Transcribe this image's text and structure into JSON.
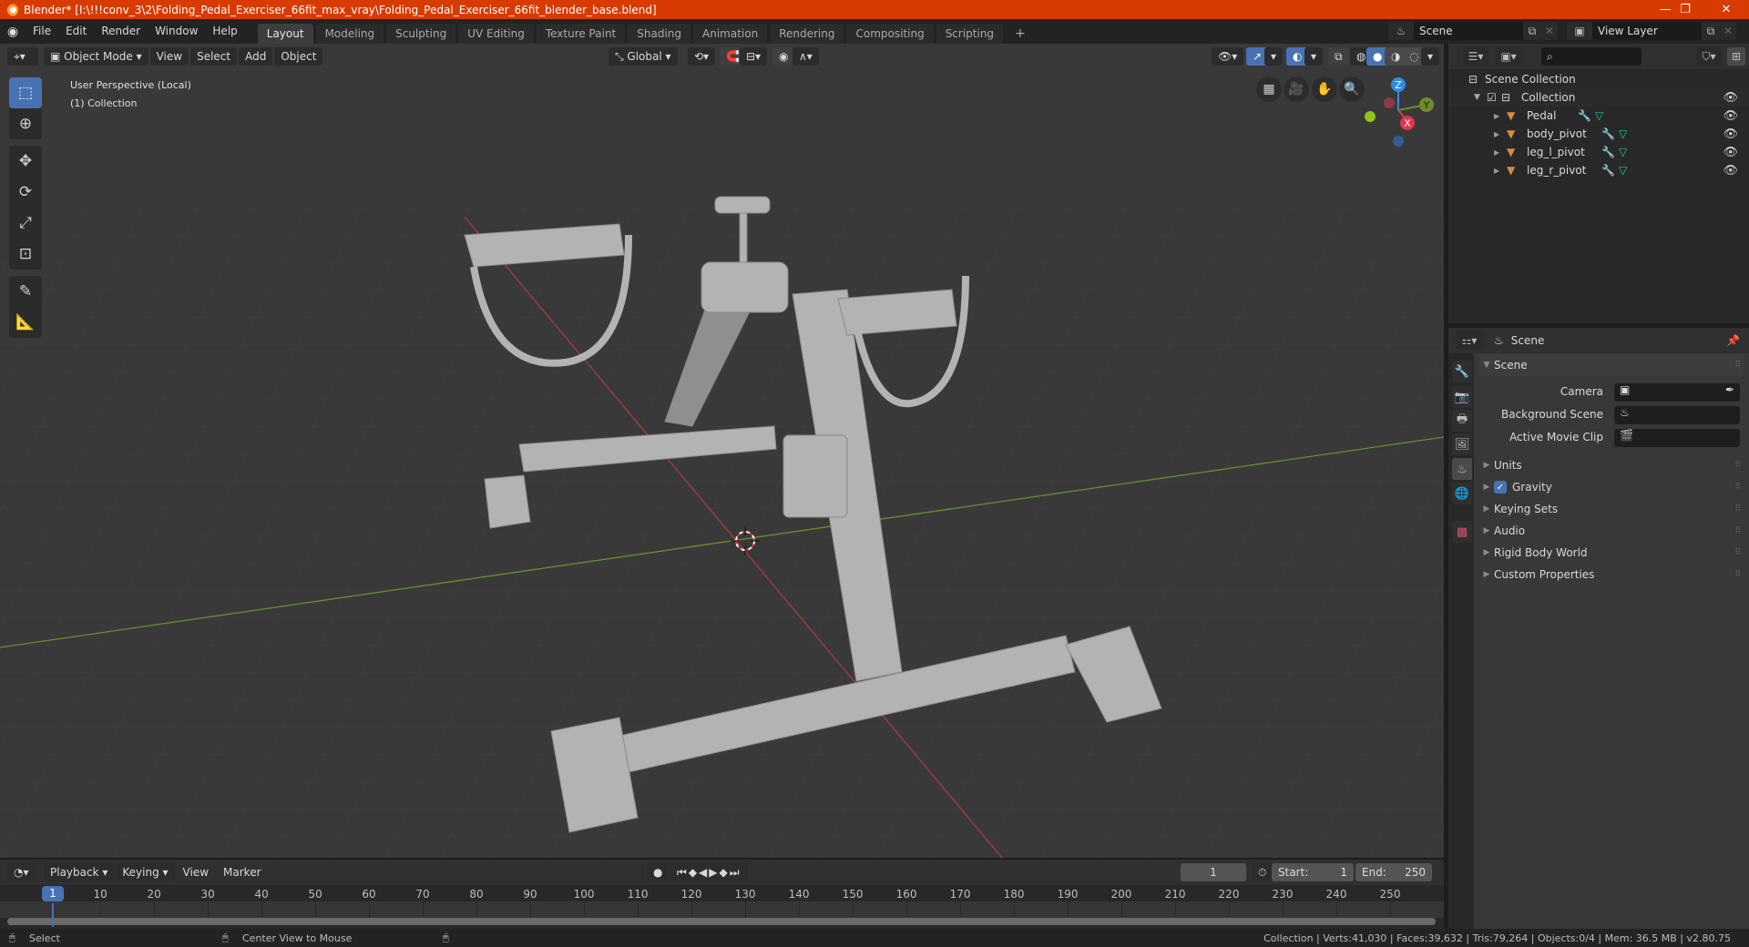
{
  "window": {
    "title": "Blender* [I:\\!!!conv_3\\2\\Folding_Pedal_Exerciser_66fit_max_vray\\Folding_Pedal_Exerciser_66fit_blender_base.blend]",
    "minimize": "—",
    "maximize": "❐",
    "close": "✕"
  },
  "menus": [
    "File",
    "Edit",
    "Render",
    "Window",
    "Help"
  ],
  "workspaces": [
    {
      "label": "Layout",
      "active": true
    },
    {
      "label": "Modeling"
    },
    {
      "label": "Sculpting"
    },
    {
      "label": "UV Editing"
    },
    {
      "label": "Texture Paint"
    },
    {
      "label": "Shading"
    },
    {
      "label": "Animation"
    },
    {
      "label": "Rendering"
    },
    {
      "label": "Compositing"
    },
    {
      "label": "Scripting"
    }
  ],
  "add_workspace": "+",
  "scene_selector": {
    "value": "Scene"
  },
  "view_layer_selector": {
    "value": "View Layer"
  },
  "viewport_header": {
    "mode": "Object Mode",
    "menus": [
      "View",
      "Select",
      "Add",
      "Object"
    ],
    "orientation": "Global"
  },
  "viewport": {
    "perspective": "User Perspective (Local)",
    "collection": "(1) Collection",
    "gizmo": {
      "z": "Z",
      "y": "Y",
      "x": "X"
    },
    "colors": {
      "x_axis": "#c9434c",
      "y_axis": "#7a9b2a",
      "z_axis": "#2e8be6"
    }
  },
  "outliner": {
    "search_placeholder": "",
    "root": "Scene Collection",
    "collection": "Collection",
    "objects": [
      {
        "name": "Pedal"
      },
      {
        "name": "body_pivot"
      },
      {
        "name": "leg_l_pivot"
      },
      {
        "name": "leg_r_pivot"
      }
    ]
  },
  "properties": {
    "context": "Scene",
    "panel": "Scene",
    "fields": [
      {
        "label": "Camera",
        "value": ""
      },
      {
        "label": "Background Scene",
        "value": ""
      },
      {
        "label": "Active Movie Clip",
        "value": ""
      }
    ],
    "sections": [
      {
        "label": "Units"
      },
      {
        "label": "Gravity",
        "checked": true
      },
      {
        "label": "Keying Sets"
      },
      {
        "label": "Audio"
      },
      {
        "label": "Rigid Body World"
      },
      {
        "label": "Custom Properties"
      }
    ]
  },
  "timeline": {
    "menus": [
      "Playback",
      "Keying",
      "View",
      "Marker"
    ],
    "current_frame": "1",
    "start_label": "Start:",
    "start": "1",
    "end_label": "End:",
    "end": "250",
    "ticks": [
      "10",
      "20",
      "30",
      "40",
      "50",
      "60",
      "70",
      "80",
      "90",
      "100",
      "110",
      "120",
      "130",
      "140",
      "150",
      "160",
      "170",
      "180",
      "190",
      "200",
      "210",
      "220",
      "230",
      "240",
      "250"
    ],
    "playhead": "1"
  },
  "statusbar": {
    "left_action": "Select",
    "middle_action": "Center View to Mouse",
    "stats": "Collection | Verts:41,030 | Faces:39,632 | Tris:79,264 | Objects:0/4 | Mem: 36.5 MB | v2.80.75"
  },
  "accent": "#4772b3"
}
